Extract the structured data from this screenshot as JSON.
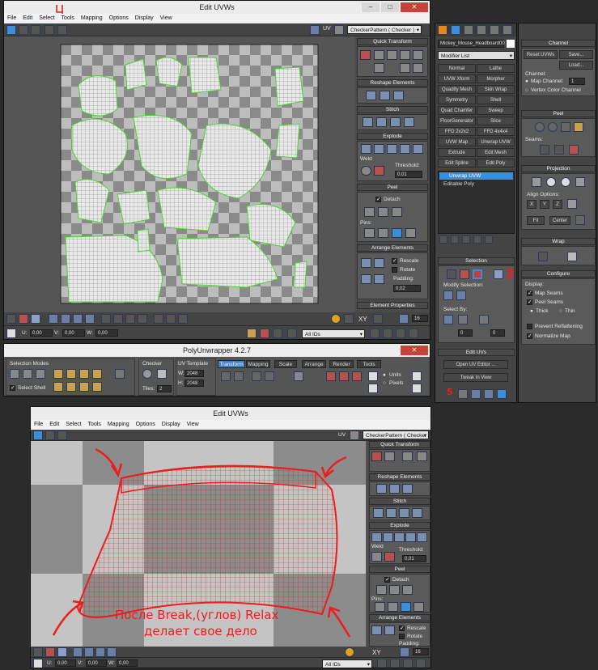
{
  "uvw_top": {
    "title": "Edit UVWs",
    "menu": [
      "File",
      "Edit",
      "Select",
      "Tools",
      "Mapping",
      "Options",
      "Display",
      "View"
    ],
    "uv_label": "UV",
    "texture_dropdown": "CheckerPattern  ( Checker )",
    "rollouts": {
      "quick_transform": "Quick Transform",
      "reshape": "Reshape Elements",
      "stitch": "Stitch",
      "explode": "Explode",
      "weld": "Weld",
      "threshold_label": "Threshold:",
      "threshold_value": "0,01",
      "peel": "Peel",
      "detach": "Detach",
      "pins": "Pins:",
      "arrange": "Arrange Elements",
      "rescale": "Rescale",
      "rotate": "Rotate",
      "padding_label": "Padding:",
      "padding_value": "0,02",
      "element_properties": "Element Properties"
    },
    "status": {
      "u_label": "U:",
      "u_value": "0,00",
      "v_label": "V:",
      "v_value": "0,00",
      "w_label": "W:",
      "w_value": "0,00",
      "xy_label": "XY",
      "zoom_value": "16",
      "all_ids": "All IDs"
    }
  },
  "modify_panel": {
    "object_name": "Mickey_Mouse_Headboard00",
    "modifier_list": "Modifier List",
    "buttons": [
      "Normal",
      "Lathe",
      "UVW Xform",
      "Morpher",
      "Quadify Mesh",
      "Skin Wrap",
      "Symmetry",
      "Shell",
      "Quad Chamfer",
      "Sweep",
      "FloorGenerator",
      "Slice",
      "FFD 2x2x2",
      "FFD 4x4x4",
      "UVW Map",
      "Unwrap UVW",
      "Extrude",
      "Edit Mesh",
      "Edit Spline",
      "Edit Poly"
    ],
    "stack": [
      "Unwrap UVW",
      "Editable Poly"
    ],
    "selection_title": "Selection",
    "modify_selection": "Modify Selection:",
    "select_by": "Select By:",
    "spin_a": "0",
    "spin_b": "0",
    "edit_uvs": "Edit UVs",
    "open_uv_editor": "Open UV Editor ...",
    "tweak_in_view": "Tweak In View",
    "annot_num": "2"
  },
  "channel_panel": {
    "channel_title": "Channel",
    "reset_uvws": "Reset UVWs",
    "save": "Save...",
    "load": "Load...",
    "channel_label": "Channel:",
    "map_channel": "Map Channel:",
    "map_channel_value": "1",
    "vertex_color_channel": "Vertex Color Channel",
    "peel_title": "Peel",
    "seams": "Seams:",
    "projection_title": "Projection",
    "align_options": "Align Options:",
    "align_axes": [
      "X",
      "Y",
      "Z"
    ],
    "fit": "Fit",
    "center": "Center",
    "wrap_title": "Wrap",
    "configure_title": "Configure",
    "display_label": "Display:",
    "map_seams": "Map Seams",
    "peel_seams": "Peel Seams",
    "thick": "Thick",
    "thin": "Thin",
    "prevent_reflattening": "Prevent Reflattening",
    "normalize_map": "Normalize Map"
  },
  "poly": {
    "title": "PolyUnwrapper 4.2.7",
    "selection_modes": "Selection Modes",
    "select_shell": "Select Shell",
    "checker": "Checker",
    "tiles_label": "Tiles:",
    "tiles_value": "2",
    "uv_template": "UV Template",
    "w_label": "W:",
    "w_value": "2048",
    "h_label": "H:",
    "h_value": "2048",
    "tabs": [
      "Transform",
      "Mapping",
      "Scale",
      "Arrange",
      "Render",
      "Tools"
    ],
    "units": "Units",
    "pixels": "Pixels"
  },
  "uvw_bottom": {
    "title": "Edit UVWs",
    "menu": [
      "File",
      "Edit",
      "Select",
      "Tools",
      "Mapping",
      "Options",
      "Display",
      "View"
    ],
    "uv_label": "UV",
    "texture_dropdown": "CheckerPattern  ( Checker )",
    "rollouts": {
      "quick_transform": "Quick Transform",
      "reshape": "Reshape Elements",
      "stitch": "Stitch",
      "explode": "Explode",
      "weld": "Weld",
      "threshold_label": "Threshold:",
      "threshold_value": "0,01",
      "peel": "Peel",
      "detach": "Detach",
      "pins": "Pins:",
      "arrange": "Arrange Elements",
      "rescale": "Rescale",
      "rotate": "Rotate",
      "padding_label": "Padding:"
    },
    "status": {
      "u_label": "U:",
      "u_value": "0,00",
      "v_label": "V:",
      "v_value": "0,00",
      "w_label": "W:",
      "w_value": "0,00",
      "xy_label": "XY",
      "zoom_value": "16",
      "all_ids": "All IDs"
    },
    "caption_line1": "После Break,(углов) Relax",
    "caption_line2": "делает свое дело"
  },
  "colors": {
    "uv_wire": "#46d82a",
    "annotation": "#ee1c1c",
    "accent_blue": "#3b8ed8"
  }
}
